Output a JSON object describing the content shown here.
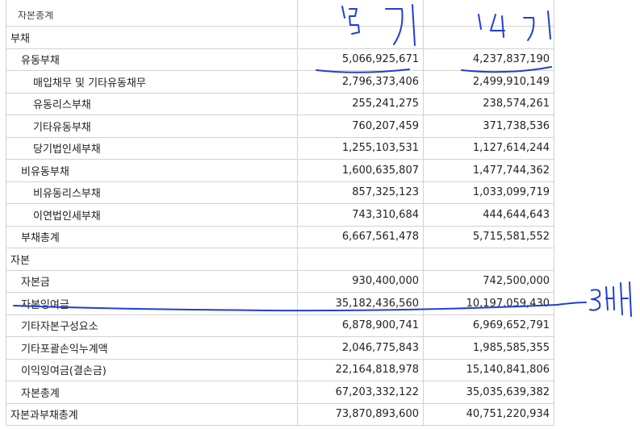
{
  "top_cut_text": "자본총계",
  "rows": [
    {
      "label": "부채",
      "level": 0,
      "v1": "",
      "v2": ""
    },
    {
      "label": "유동부채",
      "level": 1,
      "v1": "5,066,925,671",
      "v2": "4,237,837,190"
    },
    {
      "label": "매입채무 및 기타유동채무",
      "level": 2,
      "v1": "2,796,373,406",
      "v2": "2,499,910,149"
    },
    {
      "label": "유동리스부채",
      "level": 2,
      "v1": "255,241,275",
      "v2": "238,574,261"
    },
    {
      "label": "기타유동부채",
      "level": 2,
      "v1": "760,207,459",
      "v2": "371,738,536"
    },
    {
      "label": "당기법인세부채",
      "level": 2,
      "v1": "1,255,103,531",
      "v2": "1,127,614,244"
    },
    {
      "label": "비유동부채",
      "level": 1,
      "v1": "1,600,635,807",
      "v2": "1,477,744,362"
    },
    {
      "label": "비유동리스부채",
      "level": 2,
      "v1": "857,325,123",
      "v2": "1,033,099,719"
    },
    {
      "label": "이연법인세부채",
      "level": 2,
      "v1": "743,310,684",
      "v2": "444,644,643"
    },
    {
      "label": "부채총계",
      "level": 1,
      "v1": "6,667,561,478",
      "v2": "5,715,581,552"
    },
    {
      "label": "자본",
      "level": 0,
      "v1": "",
      "v2": ""
    },
    {
      "label": "자본금",
      "level": 1,
      "v1": "930,400,000",
      "v2": "742,500,000"
    },
    {
      "label": "자본잉여금",
      "level": 1,
      "v1": "35,182,436,560",
      "v2": "10,197,059,430"
    },
    {
      "label": "기타자본구성요소",
      "level": 1,
      "v1": "6,878,900,741",
      "v2": "6,969,652,791"
    },
    {
      "label": "기타포괄손익누계액",
      "level": 1,
      "v1": "2,046,775,843",
      "v2": "1,985,585,355"
    },
    {
      "label": "이익잉여금(결손금)",
      "level": 1,
      "v1": "22,164,818,978",
      "v2": "15,140,841,806"
    },
    {
      "label": "자본총계",
      "level": 1,
      "v1": "67,203,332,122",
      "v2": "35,035,639,382"
    },
    {
      "label": "자본과부채총계",
      "level": 0,
      "v1": "73,870,893,600",
      "v2": "40,751,220,934"
    }
  ],
  "annotations": {
    "col1_note": "15기",
    "col2_note": "14기",
    "side_note": "3배",
    "ink_color": "#1f3fd6"
  }
}
